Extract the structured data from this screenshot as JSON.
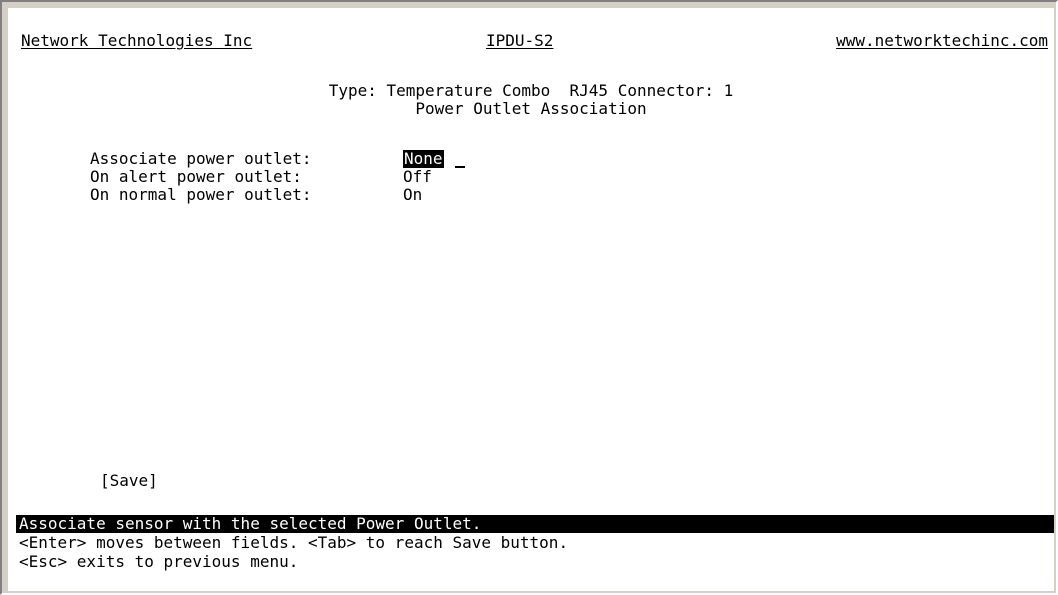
{
  "header": {
    "company": "Network Technologies Inc",
    "model": "IPDU-S2",
    "url": "www.networktechinc.com"
  },
  "title": {
    "line1": "Type: Temperature Combo  RJ45 Connector: 1",
    "line2": "Power Outlet Association"
  },
  "fields": [
    {
      "label": "Associate power outlet:",
      "value": "None"
    },
    {
      "label": "On alert power outlet:",
      "value": "Off"
    },
    {
      "label": "On normal power outlet:",
      "value": "On"
    }
  ],
  "save_label": "[Save]",
  "status_text": "Associate sensor with the selected Power Outlet.",
  "help": [
    "<Enter> moves between fields. <Tab> to reach Save button.",
    "<Esc> exits to previous menu."
  ],
  "colors": {
    "background": "#ffffff",
    "text": "#000000",
    "highlight_bg": "#000000",
    "highlight_fg": "#ffffff",
    "frame": "#d4d0c8"
  }
}
